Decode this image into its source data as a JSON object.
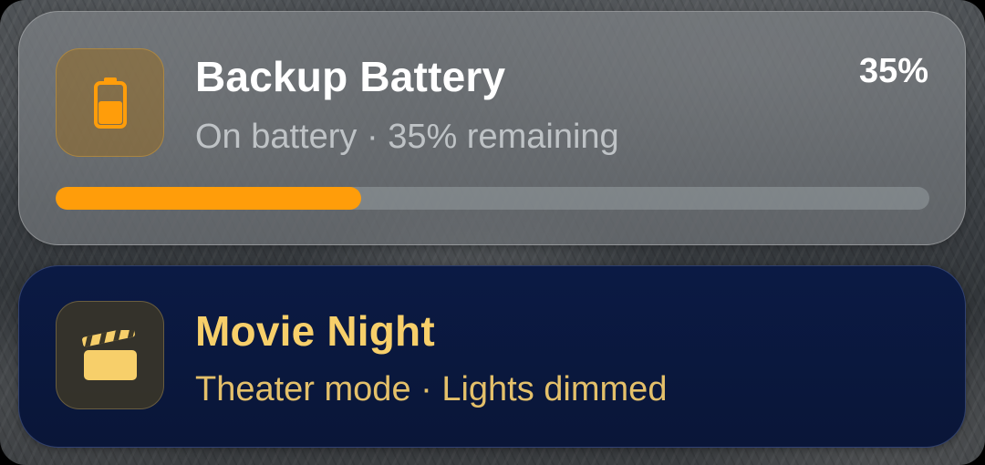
{
  "notifications": [
    {
      "title": "Backup Battery",
      "subtitle": "On battery · 35% remaining",
      "percent_label": "35%",
      "progress": 0.35,
      "icon": "battery-icon",
      "accent_color": "#FF9D0A"
    },
    {
      "title": "Movie Night",
      "subtitle": "Theater mode · Lights dimmed",
      "icon": "clapperboard-icon",
      "accent_color": "#F7CF6A"
    }
  ]
}
